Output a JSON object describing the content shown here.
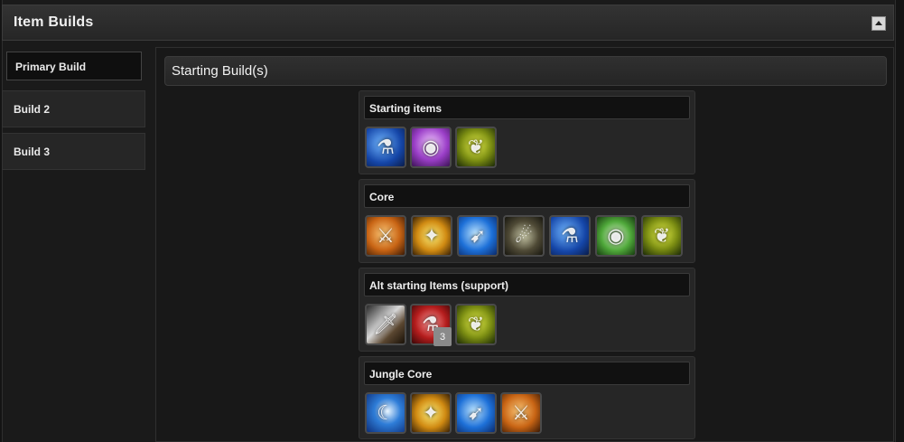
{
  "header": {
    "title": "Item Builds"
  },
  "tabs": [
    {
      "label": "Primary Build"
    },
    {
      "label": "Build 2"
    },
    {
      "label": "Build 3"
    }
  ],
  "section": {
    "title": "Starting Build(s)"
  },
  "groups": [
    {
      "title": "Starting items",
      "items": [
        {
          "icon": "mana-potion-icon"
        },
        {
          "icon": "purple-eye-ward-icon"
        },
        {
          "icon": "golden-sprout-icon"
        }
      ]
    },
    {
      "title": "Core",
      "items": [
        {
          "icon": "orange-axe-icon"
        },
        {
          "icon": "golden-boots-icon"
        },
        {
          "icon": "blue-crossbow-icon"
        },
        {
          "icon": "dark-horn-icon"
        },
        {
          "icon": "mana-potion-icon"
        },
        {
          "icon": "green-eye-ward-icon"
        },
        {
          "icon": "golden-sprout-icon"
        }
      ]
    },
    {
      "title": "Alt starting Items (support)",
      "items": [
        {
          "icon": "sword-icon"
        },
        {
          "icon": "health-potion-icon",
          "count": "3"
        },
        {
          "icon": "golden-sprout-icon"
        }
      ]
    },
    {
      "title": "Jungle Core",
      "items": [
        {
          "icon": "blue-crescent-icon"
        },
        {
          "icon": "golden-boots-icon"
        },
        {
          "icon": "blue-crossbow-icon"
        },
        {
          "icon": "orange-axe-icon"
        }
      ]
    }
  ]
}
